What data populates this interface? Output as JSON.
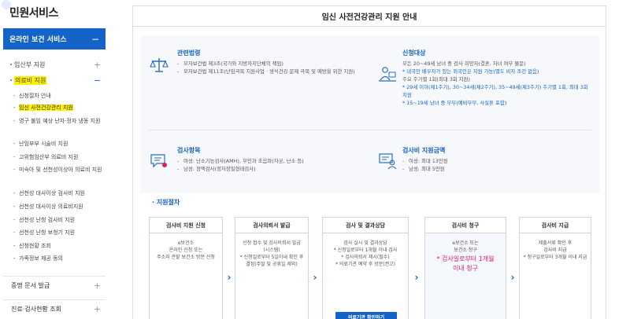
{
  "sidebar": {
    "title": "민원서비스",
    "header": "온라인 보건 서비스",
    "header_toggle": "−",
    "group1": {
      "label": "임산부 지원",
      "toggle": "+"
    },
    "group2": {
      "label": "의료비 지원",
      "toggle": "−"
    },
    "sub_items": [
      "신청절차 안내",
      "임신 사전건강관리 지원",
      "영구 불임 예상 난자·정자 냉동 지원",
      "난임부부 시술비 지원",
      "고위험임산부 의료비 지원",
      "미숙아 및 선천성이상아 의료비 지원",
      "선천성 대사이상 검사비 지원",
      "선천성 대사이상 의료비지원",
      "선천성 난청 검사비 지원",
      "선천성 난청 보청기 지원",
      "신청현황 조회",
      "가족정보 제공 동의"
    ],
    "bottom1": {
      "label": "증명 문서 발급",
      "toggle": "+"
    },
    "bottom2": {
      "label": "진료·검사현황 조회",
      "toggle": "+"
    }
  },
  "main": {
    "title": "임신 사전건강관리 지원 안내",
    "law": {
      "heading": "관련법령",
      "lines": [
        "모자보건법 제3조(국가와 지방자치단체의 책임)",
        "모자보건법 제11조(난임극복 지원사업 · 생식건강 문제 극복 및 예방을 위한 지원)"
      ]
    },
    "target": {
      "heading": "신청대상",
      "line1": "모든 20~49세 남녀 중 검사 희망자(결혼, 자녀 여부 불문)",
      "line2": "* 내국인 배우자가 있는 외국인은 지원 가능(별도 비자 조건 없음)",
      "line3": "주요 주기별 1회(최대 3회 지원)",
      "line4": "* 29세 이하(제1주기), 30~34세(제2주기), 35~49세(제3주기) 주기별 1회, 최대 3회 지원",
      "line5": "* 15~19세 남녀 중 부부(예비부부, 사실혼 포함)"
    },
    "items": {
      "heading": "검사항목",
      "lines": [
        "여성: 난소기능검사(AMH), 부인과 초음파(자궁, 난소 등)",
        "남성: 정액검사(정자정밀형태검사)"
      ]
    },
    "amount": {
      "heading": "검사비 지원금액",
      "lines": [
        "여성: 최대 13만원",
        "남성: 최대 5만원"
      ]
    },
    "procedure": {
      "heading": "· 지원절차",
      "steps": [
        {
          "title": "검사비 지원 신청",
          "l1": "e보건소",
          "l2": "온라인 신청 또는",
          "l3": "주소지 관할 보건소 방문 신청"
        },
        {
          "title": "검사의뢰서 발급",
          "l1": "신청 접수 및 검사의뢰서 발급",
          "l2": "(시스템)",
          "l3": "* 신청일로부터 5일이내 확인 후 결정(주말 및 공휴일 제외)"
        },
        {
          "title": "검사 및 결과상담",
          "l1": "검사 실시 및 결과상담",
          "l2": "* 신청일로부터 1개월 이내 검사",
          "l3": "* 검사의뢰서 제시(필수)",
          "l4": "* 의료기관 예약 후 방문(권고)",
          "button": "의료기관 확인하기"
        },
        {
          "title": "검사비 청구",
          "l1": "e보건소 또는",
          "l2": "보건소 청구",
          "l3": "* 검사일로부터 1개월",
          "l4": "이내 청구"
        },
        {
          "title": "검사비 지급",
          "l1": "제출서류 확인 후",
          "l2": "검사비 지급",
          "l3": "* 청구일로부터 3개월 이내 지급"
        }
      ],
      "arrow": "›"
    }
  }
}
